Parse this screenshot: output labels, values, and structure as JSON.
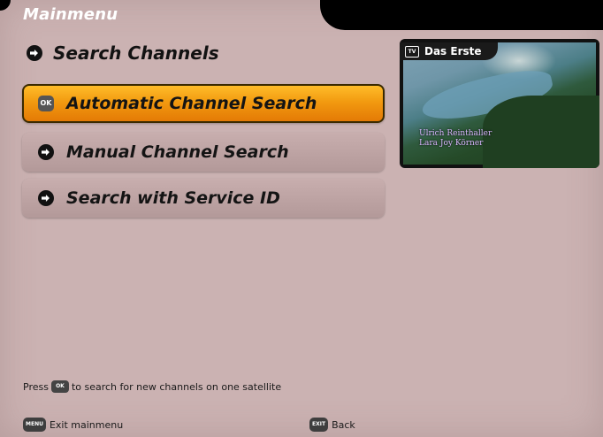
{
  "header": {
    "menu_title": "Mainmenu",
    "section_title": "Search Channels"
  },
  "menu": {
    "items": [
      {
        "label": "Automatic Channel Search",
        "selected": true
      },
      {
        "label": "Manual Channel Search",
        "selected": false
      },
      {
        "label": "Search with Service ID",
        "selected": false
      }
    ]
  },
  "preview": {
    "channel": "Das Erste",
    "tv_badge": "TV",
    "credit_1": "Ulrich Reinthaller",
    "credit_2": "Lara Joy Körner"
  },
  "hint": {
    "prefix": "Press",
    "ok_key": "OK",
    "suffix": "to search for new channels on one satellite"
  },
  "footer": {
    "menu_key": "MENU",
    "exit_mainmenu": "Exit mainmenu",
    "exit_key": "EXIT",
    "back": "Back"
  },
  "colors": {
    "background": "#cbb2b2",
    "selected_orange": "#f29a10"
  },
  "icons": {
    "menu_item": "arrow-circle-icon",
    "selected_item": "ok-key-icon"
  }
}
